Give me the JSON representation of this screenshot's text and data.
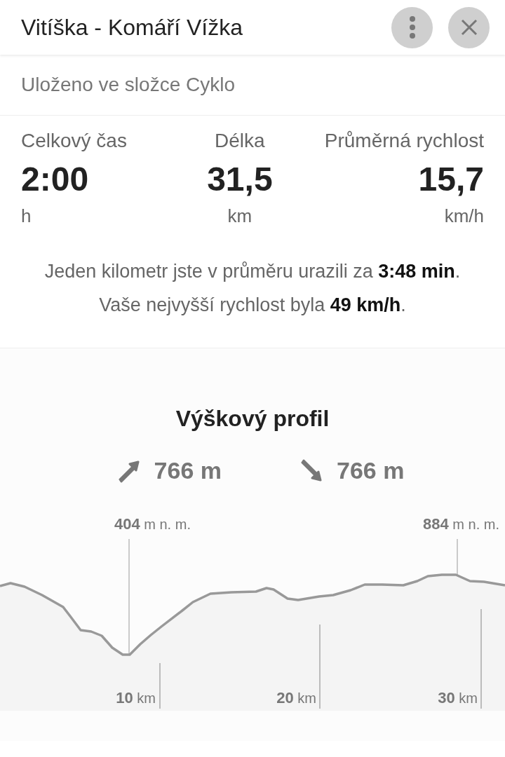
{
  "header": {
    "title": "Vitíška - Komáří Vížka"
  },
  "folder": "Uloženo ve složce Cyklo",
  "stats": [
    {
      "label": "Celkový čas",
      "value": "2:00",
      "unit": "h"
    },
    {
      "label": "Délka",
      "value": "31,5",
      "unit": "km"
    },
    {
      "label": "Průměrná rychlost",
      "value": "15,7",
      "unit": "km/h"
    }
  ],
  "summary": [
    "Jeden kilometr jste v průměru urazili za **3:48 min**.",
    "Vaše nejvyšší rychlost byla **49 km/h**."
  ],
  "profile": {
    "title": "Výškový profil",
    "ascent": "766 m",
    "descent": "766 m",
    "min_label": {
      "value": "404",
      "unit": "m n. m."
    },
    "max_label": {
      "value": "884",
      "unit": "m n. m."
    },
    "distance_marks": [
      {
        "value": "10",
        "unit": "km"
      },
      {
        "value": "20",
        "unit": "km"
      },
      {
        "value": "30",
        "unit": "km"
      }
    ]
  }
}
